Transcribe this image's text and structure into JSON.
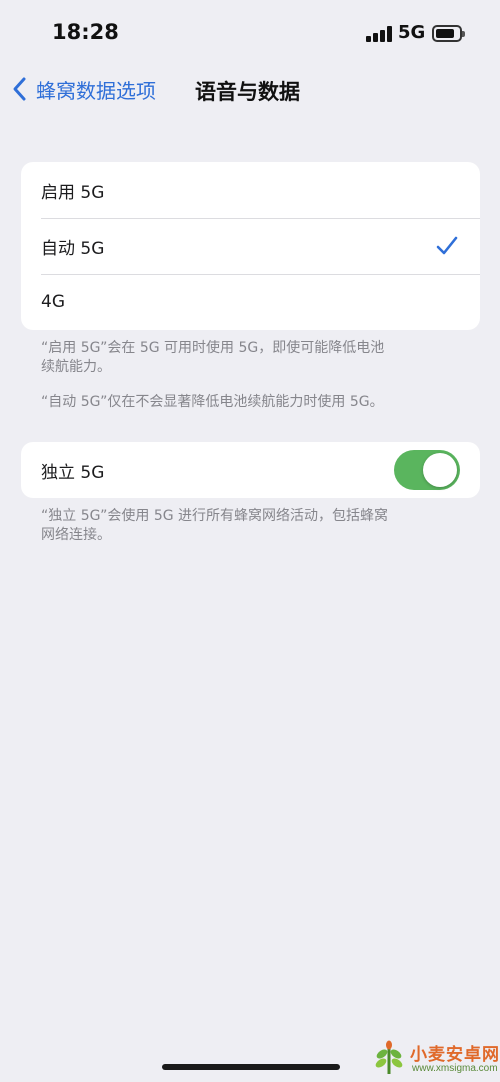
{
  "status_bar": {
    "time": "18:28",
    "network": "5G",
    "battery_level": 0.8,
    "icons": [
      "signal-icon",
      "battery-icon"
    ]
  },
  "nav": {
    "back_label": "蜂窝数据选项",
    "title": "语音与数据",
    "icons": [
      "back-chevron-icon"
    ]
  },
  "network_options": {
    "items": [
      {
        "label": "启用 5G",
        "selected": false
      },
      {
        "label": "自动 5G",
        "selected": true
      },
      {
        "label": "4G",
        "selected": false
      }
    ],
    "footnote_1": "“启用 5G”会在 5G 可用时使用 5G，即使可能降低电池续航能力。",
    "footnote_1_line1": "“启用 5G”会在 5G 可用时使用 5G，即使可能降低电池",
    "footnote_1_line2": "续航能力。",
    "footnote_2": "“自动 5G”仅在不会显著降低电池续航能力时使用 5G。"
  },
  "standalone": {
    "label": "独立 5G",
    "enabled": true,
    "footnote_line1": "“独立 5G”会使用 5G 进行所有蜂窝网络活动，包括蜂窝",
    "footnote_line2": "网络连接。"
  },
  "colors": {
    "accent": "#2f6fd8",
    "toggle_on": "#5ab55e",
    "background": "#eeeef3"
  },
  "watermark": {
    "title": "小麦安卓网",
    "url": "www.xmsigma.com"
  }
}
